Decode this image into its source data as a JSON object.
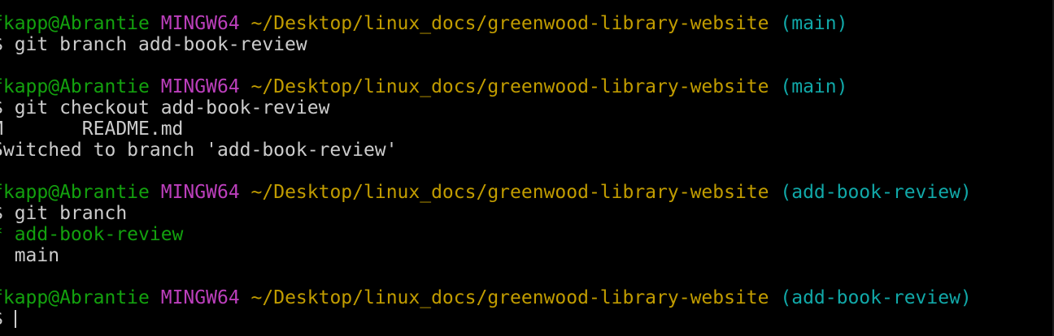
{
  "terminal": {
    "prompts": [
      {
        "user_host": "fkapp@Abrantie",
        "env": "MINGW64",
        "path": "~/Desktop/linux_docs/greenwood-library-website",
        "branch": "(main)",
        "command": "$ git branch add-book-review"
      },
      {
        "user_host": "fkapp@Abrantie",
        "env": "MINGW64",
        "path": "~/Desktop/linux_docs/greenwood-library-website",
        "branch": "(main)",
        "command": "$ git checkout add-book-review"
      },
      {
        "user_host": "fkapp@Abrantie",
        "env": "MINGW64",
        "path": "~/Desktop/linux_docs/greenwood-library-website",
        "branch": "(add-book-review)",
        "command": "$ git branch"
      },
      {
        "user_host": "fkapp@Abrantie",
        "env": "MINGW64",
        "path": "~/Desktop/linux_docs/greenwood-library-website",
        "branch": "(add-book-review)",
        "command": "$ "
      }
    ],
    "checkout_output": {
      "modified_line": "M       README.md",
      "switched_line": "Switched to branch 'add-book-review'"
    },
    "branch_output": {
      "current_branch": "* add-book-review",
      "other_branch": "  main"
    }
  },
  "colors": {
    "background": "#000000",
    "text": "#cccccc",
    "user_host": "#13a10e",
    "env": "#bc3fbc",
    "path": "#c19c00",
    "branch": "#11a8a8",
    "current_branch": "#13a10e"
  }
}
